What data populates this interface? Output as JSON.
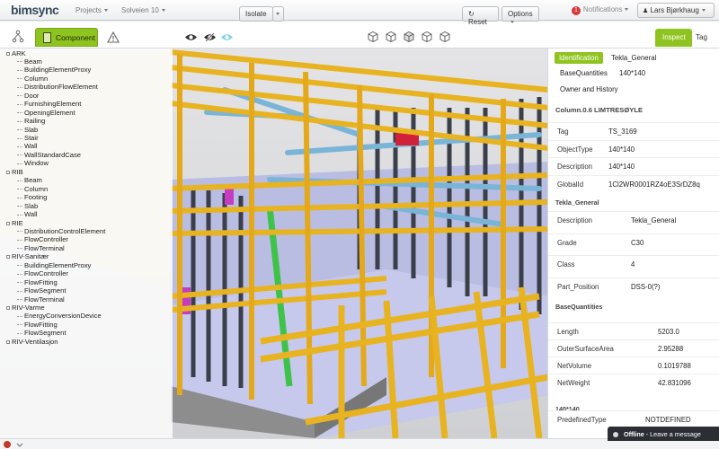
{
  "app": {
    "logo": "bimsync"
  },
  "nav": {
    "projects": "Projects",
    "project_name": "Solveien 10",
    "notifications_count": "1",
    "notifications_label": "Notifications",
    "user": "Lars Bjørkhaug"
  },
  "toolbar": {
    "component_tab": "Component",
    "isolate_label": "Isolate",
    "reset_label": "Reset",
    "options_label": "Options",
    "inspect_tab": "Inspect",
    "tag_tab": "Tag"
  },
  "tree": {
    "groups": [
      {
        "label": "ARK",
        "children": [
          "Beam",
          "BuildingElementProxy",
          "Column",
          "DistributionFlowElement",
          "Door",
          "FurnishingElement",
          "OpeningElement",
          "Railing",
          "Slab",
          "Stair",
          "Wall",
          "WallStandardCase",
          "Window"
        ]
      },
      {
        "label": "RIB",
        "children": [
          "Beam",
          "Column",
          "Footing",
          "Slab",
          "Wall"
        ]
      },
      {
        "label": "RIE",
        "children": [
          "DistributionControlElement",
          "FlowController",
          "FlowTerminal"
        ]
      },
      {
        "label": "RIV-Sanitær",
        "children": [
          "BuildingElementProxy",
          "FlowController",
          "FlowFitting",
          "FlowSegment",
          "FlowTerminal"
        ]
      },
      {
        "label": "RIV-Varme",
        "children": [
          "EnergyConversionDevice",
          "FlowFitting",
          "FlowSegment"
        ]
      },
      {
        "label": "RIV-Ventilasjon",
        "children": []
      }
    ]
  },
  "inspector": {
    "tabs": [
      {
        "label": "Identification",
        "value": "Tekla_General"
      },
      {
        "label": "BaseQuantities",
        "value": "140*140"
      },
      {
        "label": "Owner and History",
        "value": ""
      }
    ],
    "title": "Column.0.6 LIMTRESØYLE",
    "identity": [
      {
        "key": "Tag",
        "value": "TS_3169"
      },
      {
        "key": "ObjectType",
        "value": "140*140"
      },
      {
        "key": "Description",
        "value": "140*140"
      },
      {
        "key": "GlobalId",
        "value": "1Cl2WR0001RZ4oE3SrDZ8q"
      }
    ],
    "tekla_title": "Tekla_General",
    "tekla": [
      {
        "key": "Description",
        "value": "Tekla_General"
      },
      {
        "key": "Grade",
        "value": "C30"
      },
      {
        "key": "Class",
        "value": "4"
      },
      {
        "key": "Part_Position",
        "value": "DSS-0(?)"
      }
    ],
    "basequant_title": "BaseQuantities",
    "basequant": [
      {
        "key": "Length",
        "value": "5203.0"
      },
      {
        "key": "OuterSurfaceArea",
        "value": "2.95288"
      },
      {
        "key": "NetVolume",
        "value": "0.1019788"
      },
      {
        "key": "NetWeight",
        "value": "42.831096"
      }
    ],
    "size_title": "140*140",
    "size": [
      {
        "key": "PredefinedType",
        "value": "NOTDEFINED"
      }
    ]
  },
  "footer": {
    "offline_label": "Offline",
    "offline_msg": "Leave a message"
  },
  "colors": {
    "accent_green": "#8fc31f",
    "timber": "#e8b320",
    "badge_red": "#d9363e"
  }
}
